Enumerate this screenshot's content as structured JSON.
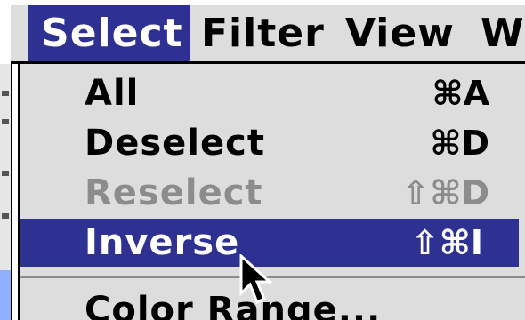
{
  "menubar": {
    "items": [
      {
        "label": "Select",
        "active": true
      },
      {
        "label": "Filter"
      },
      {
        "label": "View"
      },
      {
        "label": "W"
      }
    ]
  },
  "dropdown": {
    "items": [
      {
        "label": "All",
        "shortcut": "⌘A",
        "state": "enabled"
      },
      {
        "label": "Deselect",
        "shortcut": "⌘D",
        "state": "enabled"
      },
      {
        "label": "Reselect",
        "shortcut": "⇧⌘D",
        "state": "disabled"
      },
      {
        "label": "Inverse",
        "shortcut": "⇧⌘I",
        "state": "highlighted"
      },
      {
        "label": "Color Range...",
        "shortcut": "",
        "state": "enabled"
      }
    ]
  },
  "colors": {
    "highlight": "#2e3192",
    "menu_bg": "#dddddd",
    "disabled_text": "#8c8c8c"
  },
  "cursor": {
    "icon": "arrow-pointer-icon"
  }
}
